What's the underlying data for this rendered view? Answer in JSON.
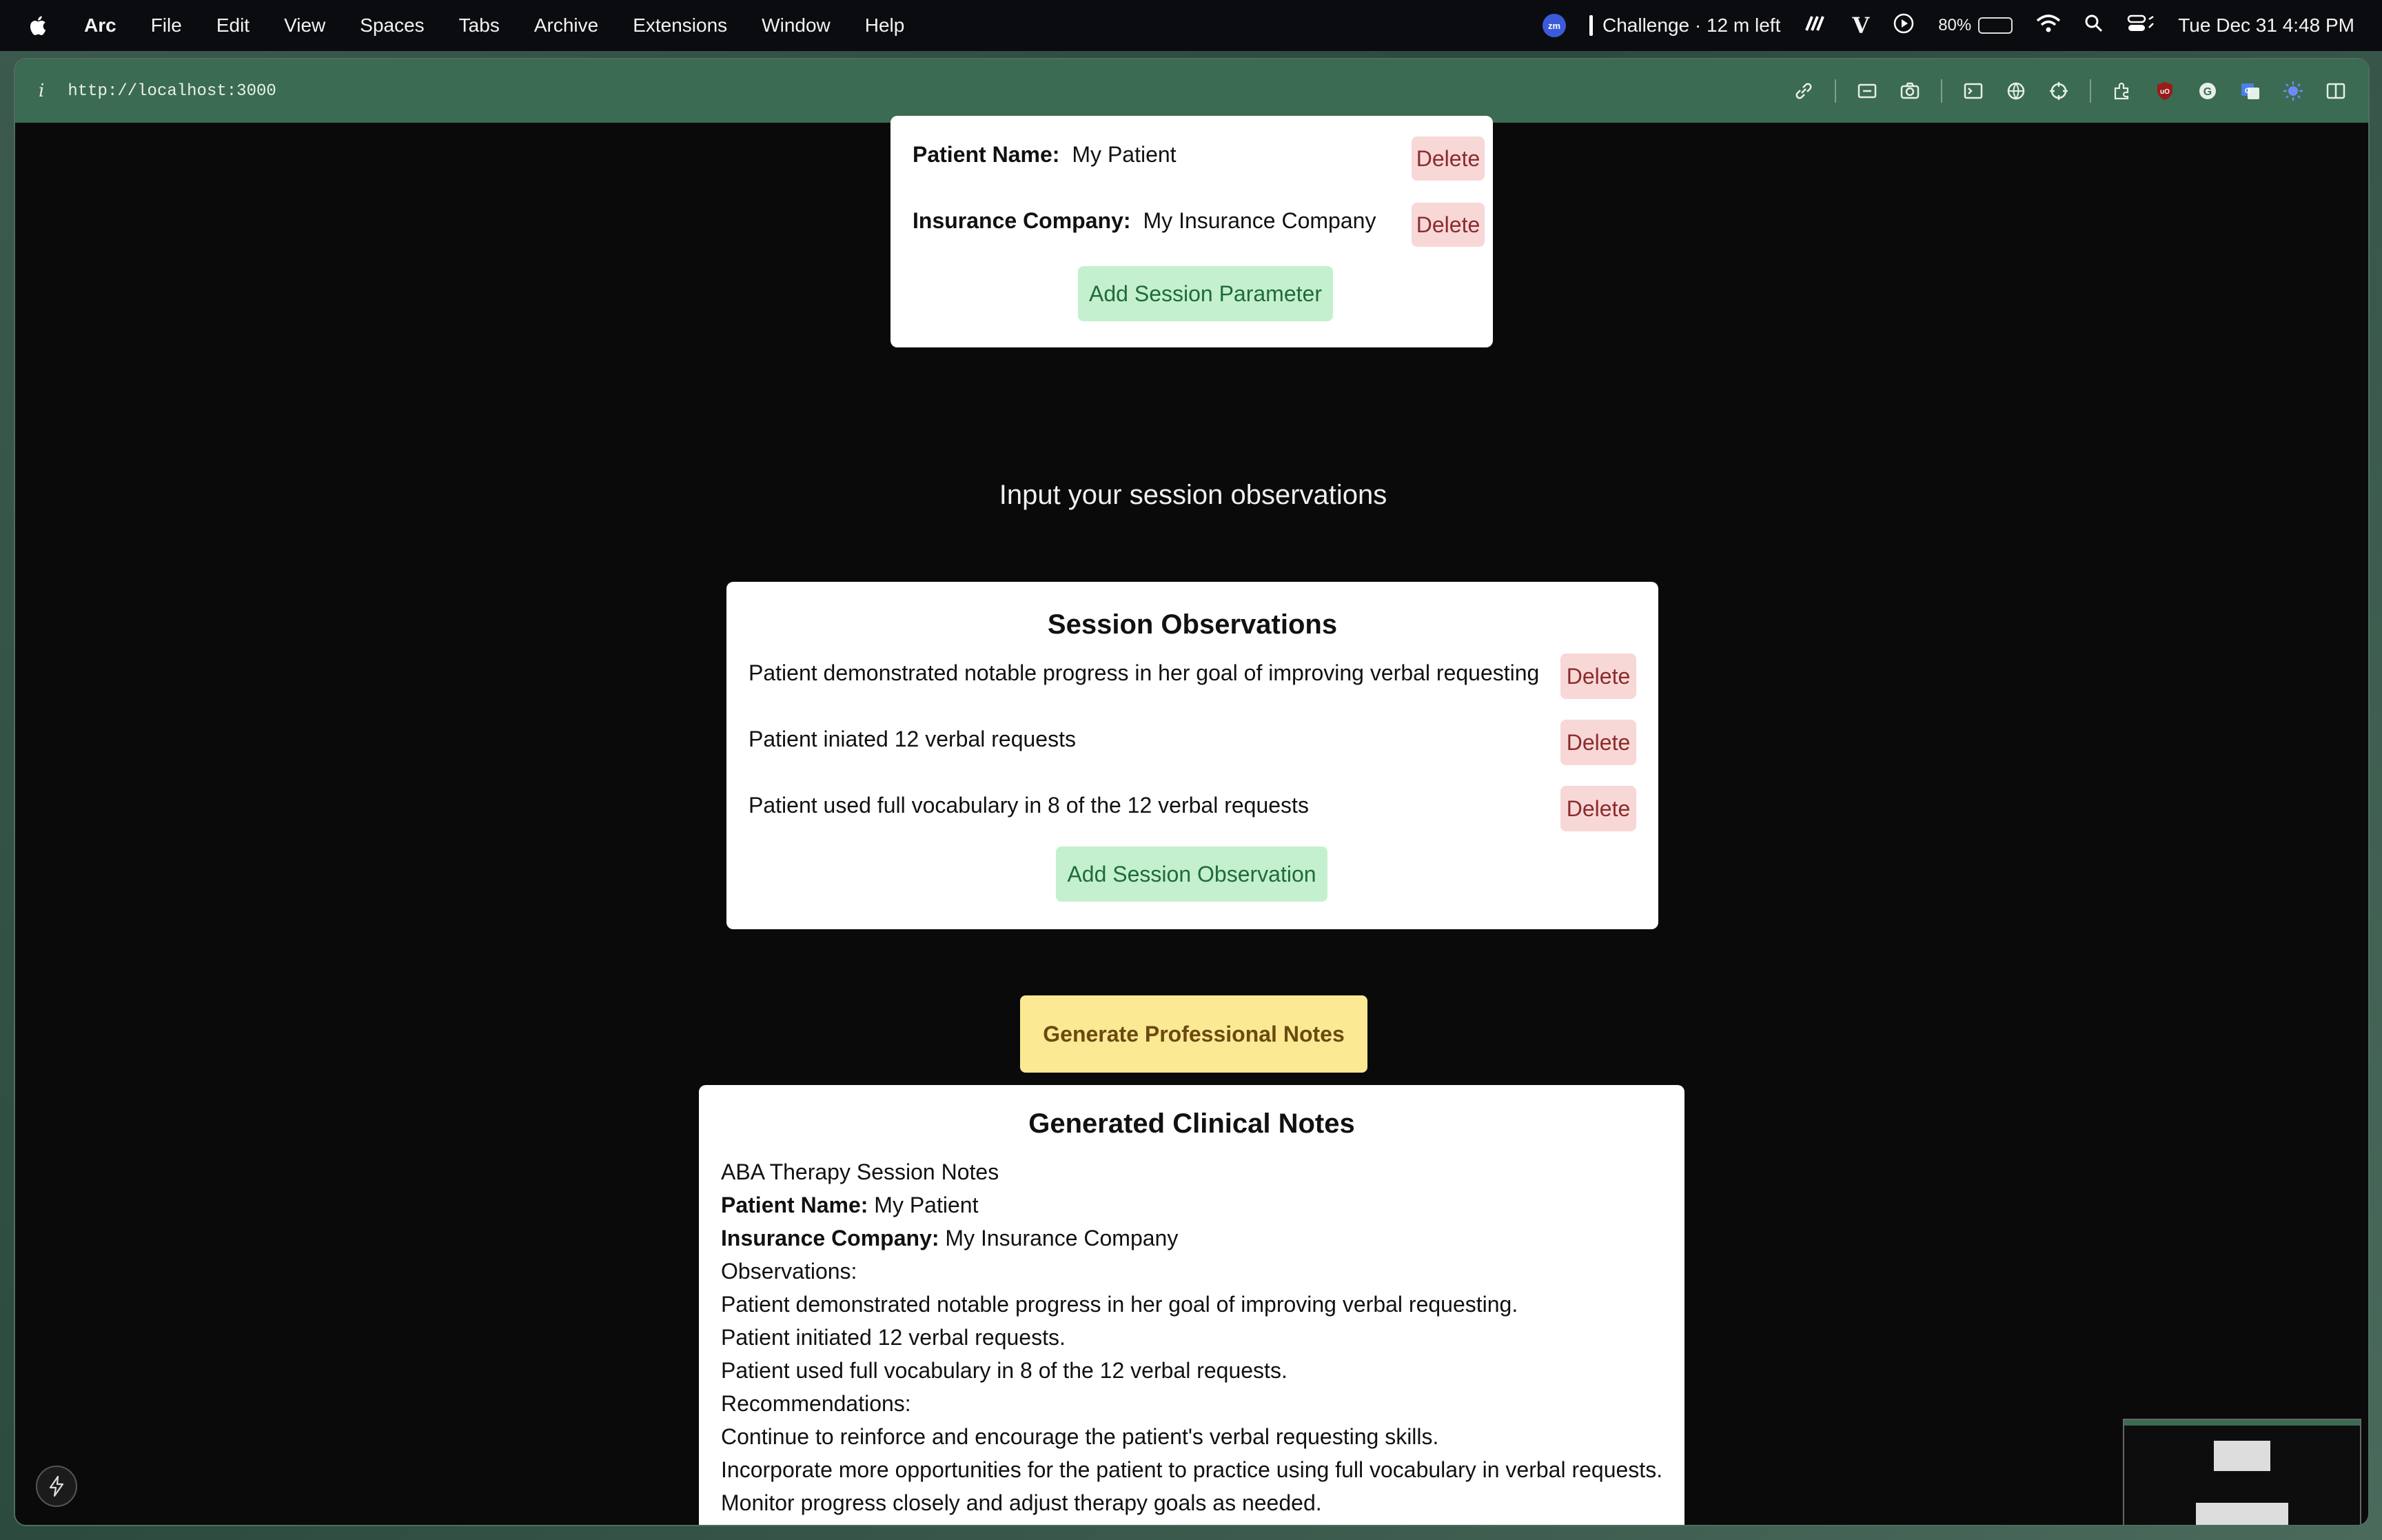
{
  "menubar": {
    "app": "Arc",
    "items": [
      "File",
      "Edit",
      "View",
      "Spaces",
      "Tabs",
      "Archive",
      "Extensions",
      "Window",
      "Help"
    ],
    "zoom_badge": "zm",
    "challenge": "Challenge · 12 m left",
    "battery": "80%",
    "battery_level": 0.8,
    "datetime": "Tue Dec 31  4:48 PM"
  },
  "browser": {
    "info_icon": "i",
    "url": "http://localhost:3000"
  },
  "parameters": {
    "rows": [
      {
        "label": "Patient Name:",
        "value": "My Patient",
        "delete": "Delete"
      },
      {
        "label": "Insurance Company:",
        "value": "My Insurance Company",
        "delete": "Delete"
      }
    ],
    "add_label": "Add Session Parameter"
  },
  "prompt": "Input your session observations",
  "observations": {
    "title": "Session Observations",
    "rows": [
      {
        "text": "Patient demonstrated notable progress in her goal of improving verbal requesting",
        "delete": "Delete"
      },
      {
        "text": "Patient iniated 12 verbal requests",
        "delete": "Delete"
      },
      {
        "text": "Patient used full vocabulary in 8 of the 12 verbal requests",
        "delete": "Delete"
      }
    ],
    "add_label": "Add Session Observation"
  },
  "generate_label": "Generate Professional Notes",
  "notes": {
    "title": "Generated Clinical Notes",
    "heading": "ABA Therapy Session Notes",
    "patient_label": "Patient Name:",
    "patient_value": " My Patient",
    "insurance_label": "Insurance Company:",
    "insurance_value": " My Insurance Company",
    "observations_label": "Observations:",
    "obs1": "Patient demonstrated notable progress in her goal of improving verbal requesting.",
    "obs2": "Patient initiated 12 verbal requests.",
    "obs3": "Patient used full vocabulary in 8 of the 12 verbal requests.",
    "recommendations_label": "Recommendations:",
    "rec1": "Continue to reinforce and encourage the patient's verbal requesting skills.",
    "rec2": "Incorporate more opportunities for the patient to practice using full vocabulary in verbal requests.",
    "rec3": "Monitor progress closely and adjust therapy goals as needed."
  }
}
